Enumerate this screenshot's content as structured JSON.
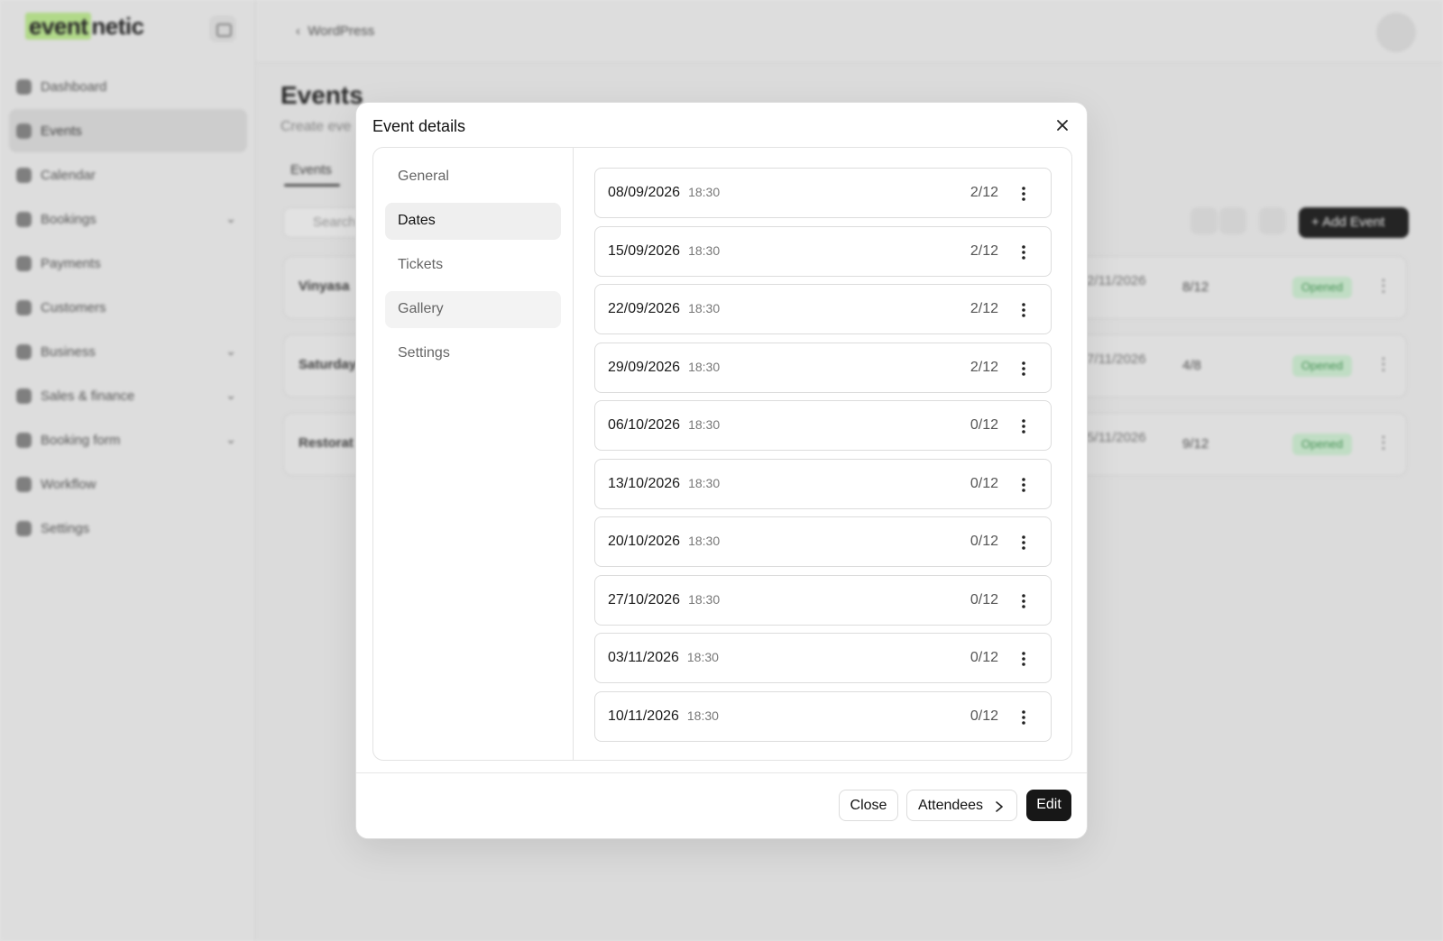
{
  "app": {
    "logo": {
      "part1": "event",
      "part2": "netic"
    },
    "sidebar": {
      "items": [
        {
          "label": "Dashboard",
          "icon": "dashboard-icon"
        },
        {
          "label": "Events",
          "icon": "calendar-icon",
          "active": true
        },
        {
          "label": "Calendar",
          "icon": "calendar-icon"
        },
        {
          "label": "Bookings",
          "icon": "bookings-icon",
          "expandable": true
        },
        {
          "label": "Payments",
          "icon": "payments-icon"
        },
        {
          "label": "Customers",
          "icon": "customers-icon"
        },
        {
          "label": "Business",
          "icon": "business-icon",
          "expandable": true
        },
        {
          "label": "Sales & finance",
          "icon": "finance-icon",
          "expandable": true
        },
        {
          "label": "Booking form",
          "icon": "form-icon",
          "expandable": true
        },
        {
          "label": "Workflow",
          "icon": "workflow-icon"
        },
        {
          "label": "Settings",
          "icon": "settings-icon"
        }
      ]
    },
    "topbar": {
      "back_label": "WordPress"
    },
    "main": {
      "title": "Events",
      "subtitle": "Create eve",
      "tab": "Events",
      "search_placeholder": "Search",
      "add_button": "+ Add Event",
      "rows": [
        {
          "title": "Vinyasa",
          "date": "2/11/2026",
          "count": "8/12",
          "status": "Opened"
        },
        {
          "title": "Saturday",
          "date": "7/11/2026",
          "count": "4/8",
          "status": "Opened"
        },
        {
          "title": "Restorat",
          "date": "5/11/2026",
          "count": "9/12",
          "status": "Opened"
        }
      ]
    }
  },
  "modal": {
    "title": "Event details",
    "tabs": [
      {
        "label": "General"
      },
      {
        "label": "Dates",
        "active": true
      },
      {
        "label": "Tickets"
      },
      {
        "label": "Gallery",
        "hover": true
      },
      {
        "label": "Settings"
      }
    ],
    "dates": [
      {
        "date": "08/09/2026",
        "time": "18:30",
        "capacity": "2/12"
      },
      {
        "date": "15/09/2026",
        "time": "18:30",
        "capacity": "2/12"
      },
      {
        "date": "22/09/2026",
        "time": "18:30",
        "capacity": "2/12"
      },
      {
        "date": "29/09/2026",
        "time": "18:30",
        "capacity": "2/12"
      },
      {
        "date": "06/10/2026",
        "time": "18:30",
        "capacity": "0/12"
      },
      {
        "date": "13/10/2026",
        "time": "18:30",
        "capacity": "0/12"
      },
      {
        "date": "20/10/2026",
        "time": "18:30",
        "capacity": "0/12"
      },
      {
        "date": "27/10/2026",
        "time": "18:30",
        "capacity": "0/12"
      },
      {
        "date": "03/11/2026",
        "time": "18:30",
        "capacity": "0/12"
      },
      {
        "date": "10/11/2026",
        "time": "18:30",
        "capacity": "0/12"
      }
    ],
    "footer": {
      "close_label": "Close",
      "attendees_label": "Attendees",
      "edit_label": "Edit"
    }
  },
  "colors": {
    "accent_dark": "#171717",
    "logo_highlight": "#b9e28f",
    "status_green": "#4a9a5a"
  }
}
